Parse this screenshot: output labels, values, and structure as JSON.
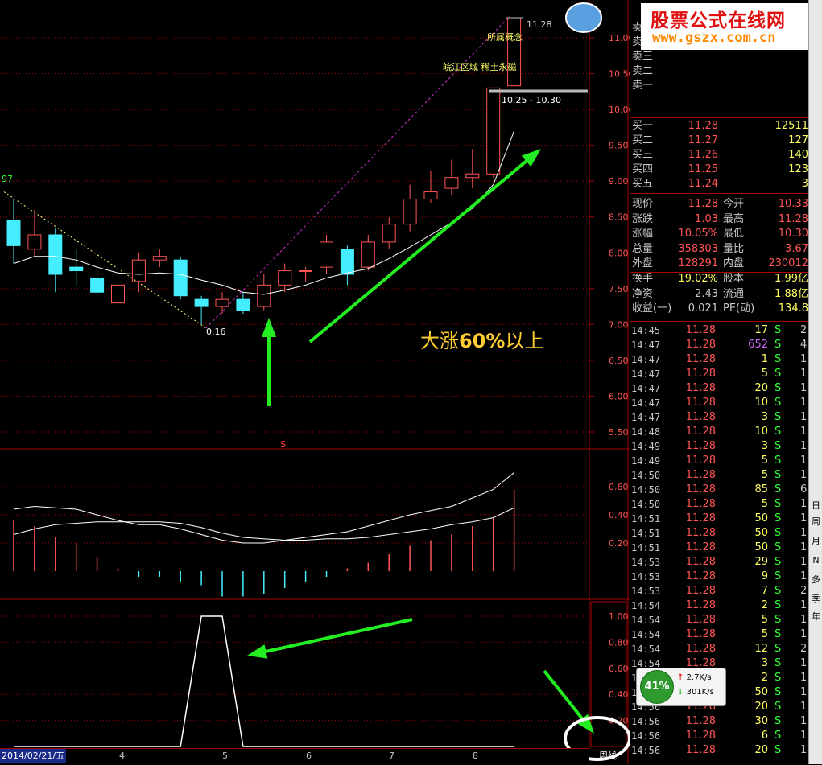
{
  "banner": {
    "title": "股票公式在线网",
    "url": "www.gszx.com.cn"
  },
  "chart": {
    "price_ticks": [
      "11.00",
      "10.50",
      "10.00",
      "9.50",
      "9.00",
      "8.50",
      "8.00",
      "7.50",
      "7.00",
      "6.50",
      "6.00",
      "5.50"
    ],
    "macd_ticks": [
      "0.60",
      "0.40",
      "0.20"
    ],
    "ind_ticks": [
      "1.00",
      "0.80",
      "0.60",
      "0.40",
      "0.20"
    ],
    "high_label": "11.28",
    "concept_label": "所属概念",
    "region_label": "皖江区域 稀土永磁",
    "range_label": "10.25 - 10.30",
    "low_label": "0.16",
    "left_label": "97",
    "marker": "$",
    "big_text_pre": "大涨",
    "big_text_bold": "60%",
    "big_text_post": "以上",
    "date": "2014/02/21/五",
    "months": [
      "4",
      "5",
      "6",
      "7",
      "8"
    ],
    "period": "周线"
  },
  "chart_data": {
    "type": "candlestick",
    "candles": [
      {
        "o": 8.45,
        "c": 8.1,
        "h": 8.75,
        "l": 7.85
      },
      {
        "o": 8.05,
        "c": 8.25,
        "h": 8.6,
        "l": 7.95
      },
      {
        "o": 8.25,
        "c": 7.7,
        "h": 8.35,
        "l": 7.45
      },
      {
        "o": 7.8,
        "c": 7.75,
        "h": 8.05,
        "l": 7.55
      },
      {
        "o": 7.65,
        "c": 7.45,
        "h": 7.75,
        "l": 7.4
      },
      {
        "o": 7.3,
        "c": 7.55,
        "h": 7.7,
        "l": 7.2
      },
      {
        "o": 7.6,
        "c": 7.9,
        "h": 8.0,
        "l": 7.45
      },
      {
        "o": 7.9,
        "c": 7.95,
        "h": 8.05,
        "l": 7.8
      },
      {
        "o": 7.9,
        "c": 7.4,
        "h": 7.95,
        "l": 7.35
      },
      {
        "o": 7.35,
        "c": 7.25,
        "h": 7.4,
        "l": 7.0
      },
      {
        "o": 7.25,
        "c": 7.35,
        "h": 7.45,
        "l": 7.15
      },
      {
        "o": 7.35,
        "c": 7.2,
        "h": 7.45,
        "l": 7.15
      },
      {
        "o": 7.25,
        "c": 7.55,
        "h": 7.7,
        "l": 7.2
      },
      {
        "o": 7.55,
        "c": 7.75,
        "h": 7.85,
        "l": 7.45
      },
      {
        "o": 7.75,
        "c": 7.75,
        "h": 7.8,
        "l": 7.6
      },
      {
        "o": 7.8,
        "c": 8.15,
        "h": 8.25,
        "l": 7.7
      },
      {
        "o": 8.05,
        "c": 7.7,
        "h": 8.1,
        "l": 7.55
      },
      {
        "o": 7.8,
        "c": 8.15,
        "h": 8.25,
        "l": 7.75
      },
      {
        "o": 8.15,
        "c": 8.4,
        "h": 8.5,
        "l": 8.05
      },
      {
        "o": 8.4,
        "c": 8.75,
        "h": 8.95,
        "l": 8.3
      },
      {
        "o": 8.75,
        "c": 8.85,
        "h": 9.15,
        "l": 8.7
      },
      {
        "o": 8.9,
        "c": 9.05,
        "h": 9.3,
        "l": 8.8
      },
      {
        "o": 9.05,
        "c": 9.1,
        "h": 9.45,
        "l": 8.9
      },
      {
        "o": 9.1,
        "c": 10.3,
        "h": 10.3,
        "l": 9.05
      },
      {
        "o": 10.33,
        "c": 11.28,
        "h": 11.28,
        "l": 10.3
      }
    ],
    "ma": [
      7.85,
      7.95,
      7.95,
      7.9,
      7.8,
      7.72,
      7.7,
      7.72,
      7.7,
      7.62,
      7.55,
      7.45,
      7.42,
      7.48,
      7.55,
      7.65,
      7.72,
      7.78,
      7.92,
      8.08,
      8.25,
      8.42,
      8.62,
      8.95,
      9.7
    ],
    "macd_line": [
      0.44,
      0.46,
      0.45,
      0.44,
      0.4,
      0.36,
      0.33,
      0.33,
      0.3,
      0.26,
      0.22,
      0.2,
      0.2,
      0.22,
      0.24,
      0.26,
      0.28,
      0.32,
      0.36,
      0.4,
      0.43,
      0.46,
      0.52,
      0.58,
      0.7
    ],
    "signal_line": [
      0.26,
      0.3,
      0.33,
      0.34,
      0.35,
      0.35,
      0.35,
      0.35,
      0.34,
      0.31,
      0.27,
      0.24,
      0.23,
      0.22,
      0.22,
      0.23,
      0.23,
      0.24,
      0.26,
      0.28,
      0.3,
      0.33,
      0.35,
      0.38,
      0.45
    ],
    "histogram": [
      0.36,
      0.32,
      0.24,
      0.2,
      0.1,
      0.02,
      -0.04,
      -0.04,
      -0.08,
      -0.1,
      -0.18,
      -0.18,
      -0.16,
      -0.12,
      -0.08,
      -0.04,
      0.02,
      0.06,
      0.12,
      0.18,
      0.22,
      0.26,
      0.32,
      0.38,
      0.58
    ],
    "indicator": [
      0,
      0,
      0,
      0,
      0,
      0,
      0,
      0,
      0,
      1,
      1,
      0,
      0,
      0,
      0,
      0,
      0,
      0,
      0,
      0,
      0,
      0,
      0,
      0,
      0
    ]
  },
  "quote": {
    "sell_labels": [
      "卖五",
      "卖四",
      "卖三",
      "卖二",
      "卖一"
    ],
    "buys": [
      {
        "label": "买一",
        "price": "11.28",
        "vol": "12511"
      },
      {
        "label": "买二",
        "price": "11.27",
        "vol": "127"
      },
      {
        "label": "买三",
        "price": "11.26",
        "vol": "140"
      },
      {
        "label": "买四",
        "price": "11.25",
        "vol": "123"
      },
      {
        "label": "买五",
        "price": "11.24",
        "vol": "3"
      }
    ],
    "stats": [
      {
        "l1": "现价",
        "v1": "11.28",
        "l2": "今开",
        "v2": "10.33"
      },
      {
        "l1": "涨跌",
        "v1": "1.03",
        "l2": "最高",
        "v2": "11.28"
      },
      {
        "l1": "涨幅",
        "v1": "10.05%",
        "l2": "最低",
        "v2": "10.30"
      },
      {
        "l1": "总量",
        "v1": "358303",
        "l2": "量比",
        "v2": "3.67"
      },
      {
        "l1": "外盘",
        "v1": "128291",
        "l2": "内盘",
        "v2": "230012"
      },
      {
        "l1": "换手",
        "v1": "19.02%",
        "l2": "股本",
        "v2": "1.99亿"
      },
      {
        "l1": "净资",
        "v1": "2.43",
        "l2": "流通",
        "v2": "1.88亿"
      },
      {
        "l1": "收益(一)",
        "v1": "0.021",
        "l2": "PE(动)",
        "v2": "134.8"
      }
    ],
    "ticks": [
      {
        "t": "14:45",
        "p": "11.28",
        "q": "17",
        "s": "S",
        "x": "2"
      },
      {
        "t": "14:47",
        "p": "11.28",
        "q": "652",
        "s": "S",
        "x": "4"
      },
      {
        "t": "14:47",
        "p": "11.28",
        "q": "1",
        "s": "S",
        "x": "1"
      },
      {
        "t": "14:47",
        "p": "11.28",
        "q": "5",
        "s": "S",
        "x": "1"
      },
      {
        "t": "14:47",
        "p": "11.28",
        "q": "20",
        "s": "S",
        "x": "1"
      },
      {
        "t": "14:47",
        "p": "11.28",
        "q": "10",
        "s": "S",
        "x": "1"
      },
      {
        "t": "14:47",
        "p": "11.28",
        "q": "3",
        "s": "S",
        "x": "1"
      },
      {
        "t": "14:48",
        "p": "11.28",
        "q": "10",
        "s": "S",
        "x": "1"
      },
      {
        "t": "14:49",
        "p": "11.28",
        "q": "3",
        "s": "S",
        "x": "1"
      },
      {
        "t": "14:49",
        "p": "11.28",
        "q": "5",
        "s": "S",
        "x": "1"
      },
      {
        "t": "14:50",
        "p": "11.28",
        "q": "5",
        "s": "S",
        "x": "1"
      },
      {
        "t": "14:50",
        "p": "11.28",
        "q": "85",
        "s": "S",
        "x": "6"
      },
      {
        "t": "14:50",
        "p": "11.28",
        "q": "5",
        "s": "S",
        "x": "1"
      },
      {
        "t": "14:51",
        "p": "11.28",
        "q": "50",
        "s": "S",
        "x": "1"
      },
      {
        "t": "14:51",
        "p": "11.28",
        "q": "50",
        "s": "S",
        "x": "1"
      },
      {
        "t": "14:51",
        "p": "11.28",
        "q": "50",
        "s": "S",
        "x": "1"
      },
      {
        "t": "14:53",
        "p": "11.28",
        "q": "29",
        "s": "S",
        "x": "1"
      },
      {
        "t": "14:53",
        "p": "11.28",
        "q": "9",
        "s": "S",
        "x": "1"
      },
      {
        "t": "14:53",
        "p": "11.28",
        "q": "7",
        "s": "S",
        "x": "2"
      },
      {
        "t": "14:54",
        "p": "11.28",
        "q": "2",
        "s": "S",
        "x": "1"
      },
      {
        "t": "14:54",
        "p": "11.28",
        "q": "5",
        "s": "S",
        "x": "1"
      },
      {
        "t": "14:54",
        "p": "11.28",
        "q": "5",
        "s": "S",
        "x": "1"
      },
      {
        "t": "14:54",
        "p": "11.28",
        "q": "12",
        "s": "S",
        "x": "2"
      },
      {
        "t": "14:54",
        "p": "11.28",
        "q": "3",
        "s": "S",
        "x": "1"
      },
      {
        "t": "14:54",
        "p": "11.28",
        "q": "2",
        "s": "S",
        "x": "1"
      },
      {
        "t": "14:56",
        "p": "11.28",
        "q": "50",
        "s": "S",
        "x": "1"
      },
      {
        "t": "14:56",
        "p": "11.28",
        "q": "20",
        "s": "S",
        "x": "1"
      },
      {
        "t": "14:56",
        "p": "11.28",
        "q": "30",
        "s": "S",
        "x": "1"
      },
      {
        "t": "14:56",
        "p": "11.28",
        "q": "6",
        "s": "S",
        "x": "1"
      },
      {
        "t": "14:56",
        "p": "11.28",
        "q": "20",
        "s": "S",
        "x": "1"
      }
    ]
  },
  "gauge": {
    "pct": "41%",
    "up": "2.7K/s",
    "down": "301K/s"
  },
  "toolbar": [
    "日",
    "周",
    "月",
    "N",
    "多",
    "季",
    "年"
  ],
  "colors": {
    "up": "#ff5555",
    "down": "#44eeff",
    "grid": "#aa0000",
    "arrow": "#22ee22"
  }
}
